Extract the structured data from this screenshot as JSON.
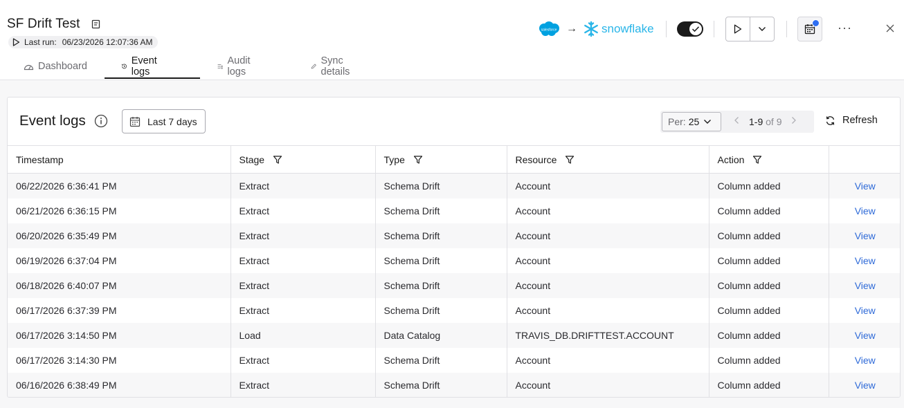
{
  "header": {
    "title": "SF Drift Test",
    "last_run_label": "Last run:",
    "last_run_value": "06/23/2026 12:07:36 AM",
    "source_logo_text": "salesforce",
    "destination_name": "snowflake",
    "arrow": "→",
    "more": "···"
  },
  "tabs": [
    {
      "label": "Dashboard",
      "icon": "dashboard-icon"
    },
    {
      "label": "Event logs",
      "icon": "history-icon",
      "active": true
    },
    {
      "label": "Audit logs",
      "icon": "audit-list-icon"
    },
    {
      "label": "Sync details",
      "icon": "pencil-icon"
    }
  ],
  "panel": {
    "title": "Event logs",
    "date_filter": "Last 7 days",
    "per_label": "Per:",
    "per_value": "25",
    "page_range": "1-9",
    "page_of": "of 9",
    "refresh_label": "Refresh"
  },
  "table": {
    "columns": [
      "Timestamp",
      "Stage",
      "Type",
      "Resource",
      "Action"
    ],
    "rows": [
      {
        "timestamp": "06/22/2026 6:36:41 PM",
        "stage": "Extract",
        "type": "Schema Drift",
        "resource": "Account",
        "action": "Column added",
        "link": "View"
      },
      {
        "timestamp": "06/21/2026 6:36:15 PM",
        "stage": "Extract",
        "type": "Schema Drift",
        "resource": "Account",
        "action": "Column added",
        "link": "View"
      },
      {
        "timestamp": "06/20/2026 6:35:49 PM",
        "stage": "Extract",
        "type": "Schema Drift",
        "resource": "Account",
        "action": "Column added",
        "link": "View"
      },
      {
        "timestamp": "06/19/2026 6:37:04 PM",
        "stage": "Extract",
        "type": "Schema Drift",
        "resource": "Account",
        "action": "Column added",
        "link": "View"
      },
      {
        "timestamp": "06/18/2026 6:40:07 PM",
        "stage": "Extract",
        "type": "Schema Drift",
        "resource": "Account",
        "action": "Column added",
        "link": "View"
      },
      {
        "timestamp": "06/17/2026 6:37:39 PM",
        "stage": "Extract",
        "type": "Schema Drift",
        "resource": "Account",
        "action": "Column added",
        "link": "View"
      },
      {
        "timestamp": "06/17/2026 3:14:50 PM",
        "stage": "Load",
        "type": "Data Catalog",
        "resource": "TRAVIS_DB.DRIFTTEST.ACCOUNT",
        "action": "Column added",
        "link": "View"
      },
      {
        "timestamp": "06/17/2026 3:14:30 PM",
        "stage": "Extract",
        "type": "Schema Drift",
        "resource": "Account",
        "action": "Column added",
        "link": "View"
      },
      {
        "timestamp": "06/16/2026 6:38:49 PM",
        "stage": "Extract",
        "type": "Schema Drift",
        "resource": "Account",
        "action": "Column added",
        "link": "View"
      }
    ]
  },
  "colors": {
    "accent": "#2e6ad8",
    "snowflake": "#29b5e8",
    "salesforce": "#00a1e0",
    "notification": "#2f6ff2"
  }
}
